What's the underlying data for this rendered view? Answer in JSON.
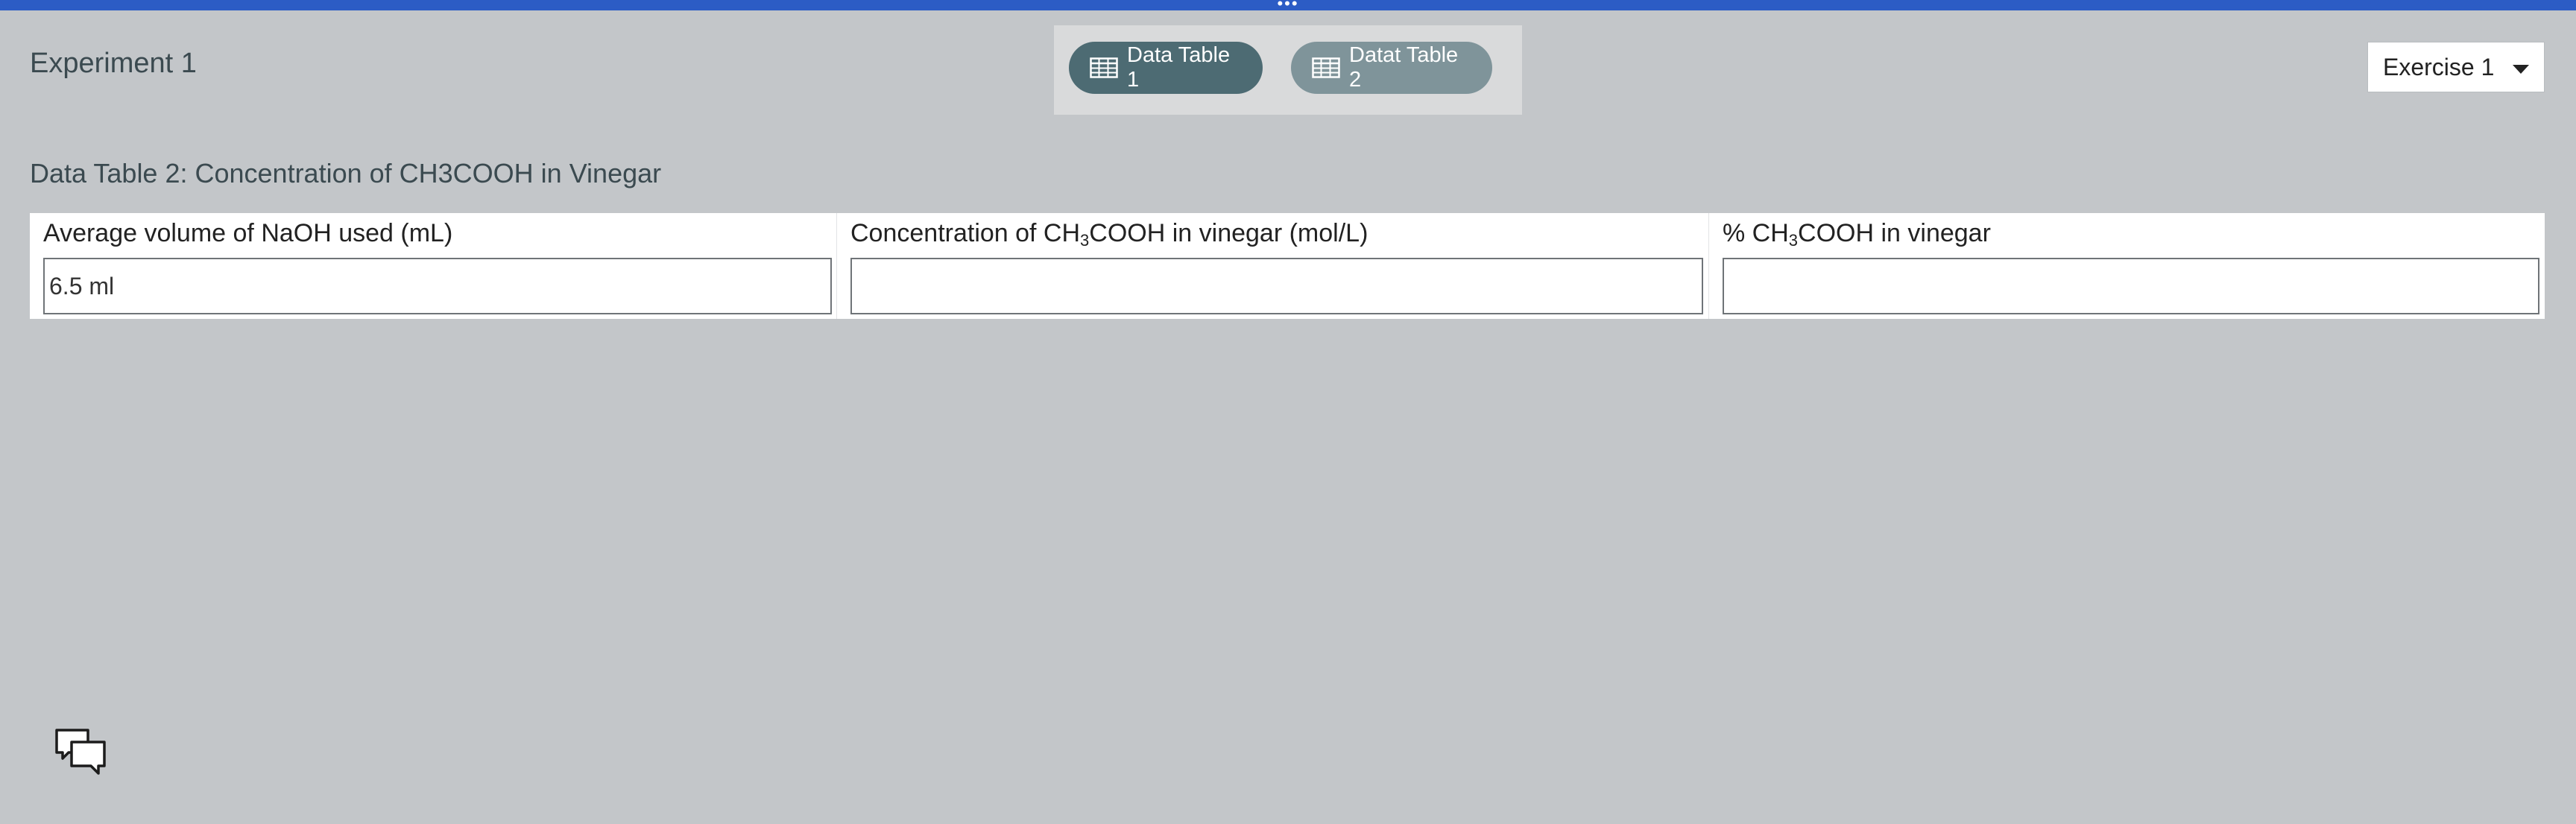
{
  "header": {
    "experiment_title": "Experiment 1",
    "exercise_select": {
      "value": "Exercise 1"
    }
  },
  "tabs": [
    {
      "label": "Data Table 1",
      "active": true
    },
    {
      "label": "Datat Table 2",
      "active": false
    }
  ],
  "section": {
    "title": "Data Table 2: Concentration of CH3COOH in Vinegar"
  },
  "table": {
    "columns": [
      {
        "pre": "Average volume of NaOH used (mL)",
        "sub": "",
        "post": ""
      },
      {
        "pre": "Concentration of CH",
        "sub": "3",
        "post": "COOH in vinegar (mol/L)"
      },
      {
        "pre": "% CH",
        "sub": "3",
        "post": "COOH in vinegar"
      }
    ],
    "values": [
      "6.5 ml",
      "",
      ""
    ]
  },
  "icons": {
    "chat": "chat-bubbles-icon",
    "table": "table-grid-icon",
    "dropdown": "chevron-down-icon",
    "drag": "drag-handle-icon"
  },
  "colors": {
    "top_bar": "#2c5cc5",
    "background": "#c3c6c9",
    "tab_active": "#4d6b73",
    "tab_inactive": "#7f949a"
  }
}
